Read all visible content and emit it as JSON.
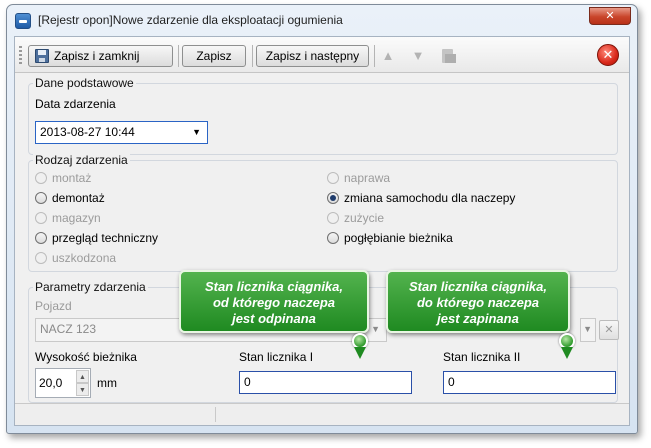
{
  "window": {
    "title": "[Rejestr opon]Nowe zdarzenie dla eksploatacji ogumienia",
    "close_symbol": "✕"
  },
  "toolbar": {
    "save_close_label": "Zapisz i zamknij",
    "save_label": "Zapisz",
    "save_next_label": "Zapisz i następny",
    "up_symbol": "▲",
    "down_symbol": "▼",
    "close_symbol": "✕"
  },
  "basic": {
    "section_title": "Dane podstawowe",
    "date_label": "Data zdarzenia",
    "date_value": "2013-08-27 10:44"
  },
  "event_type": {
    "section_title": "Rodzaj zdarzenia",
    "options": [
      {
        "label": "montaż",
        "enabled": false,
        "checked": false
      },
      {
        "label": "demontaż",
        "enabled": true,
        "checked": false
      },
      {
        "label": "magazyn",
        "enabled": false,
        "checked": false
      },
      {
        "label": "przegląd techniczny",
        "enabled": true,
        "checked": false
      },
      {
        "label": "uszkodzona",
        "enabled": false,
        "checked": false
      },
      {
        "label": "naprawa",
        "enabled": false,
        "checked": false
      },
      {
        "label": "zmiana samochodu dla naczepy",
        "enabled": true,
        "checked": true
      },
      {
        "label": "zużycie",
        "enabled": false,
        "checked": false
      },
      {
        "label": "pogłębianie bieżnika",
        "enabled": true,
        "checked": false
      }
    ]
  },
  "params": {
    "section_title": "Parametry zdarzenia",
    "vehicle_label": "Pojazd",
    "vehicle_value": "NACZ 123",
    "clear_symbol": "✕",
    "tread_label": "Wysokość bieżnika",
    "tread_value": "20,0",
    "tread_unit": "mm",
    "counter1_label": "Stan licznika I",
    "counter1_value": "0",
    "counter2_label": "Stan licznika II",
    "counter2_value": "0"
  },
  "callouts": {
    "left": [
      "Stan licznika ciągnika,",
      "od którego naczepa",
      "jest odpinana"
    ],
    "right": [
      "Stan licznika ciągnika,",
      "do którego naczepa",
      "jest zapinana"
    ]
  },
  "colors": {
    "callout_green": "#2e9a2c",
    "focus_border": "#2a64c5",
    "close_red": "#c9452b"
  }
}
